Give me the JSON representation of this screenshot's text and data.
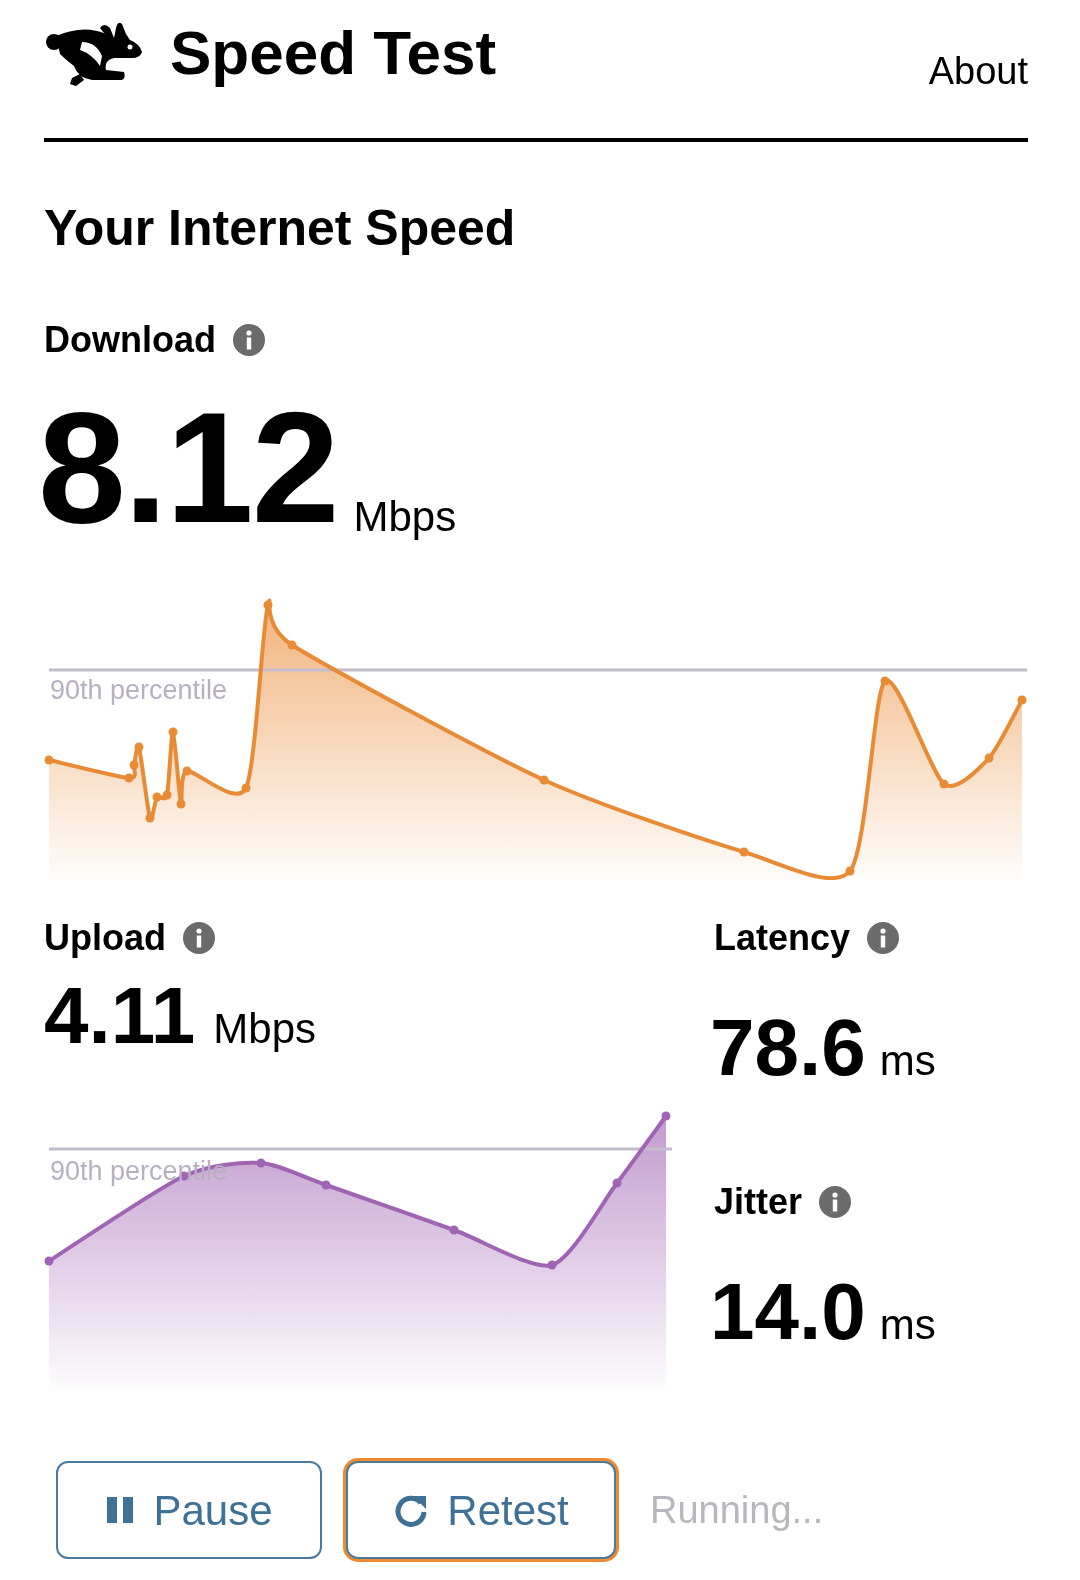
{
  "header": {
    "title": "Speed Test",
    "nav_link": "About"
  },
  "heading": "Your Internet Speed",
  "download": {
    "label": "Download",
    "value": "8.12",
    "unit": "Mbps",
    "chart": {
      "kind": "picture",
      "percentile_label": "90th percentile"
    }
  },
  "upload": {
    "label": "Upload",
    "value": "4.11",
    "unit": "Mbps",
    "chart": {
      "kind": "picture",
      "percentile_label": "90th percentile"
    }
  },
  "latency": {
    "label": "Latency",
    "value": "78.6",
    "unit": "ms"
  },
  "jitter": {
    "label": "Jitter",
    "value": "14.0",
    "unit": "ms"
  },
  "buttons": [
    {
      "kind": "pause",
      "label": "Pause",
      "focused": false
    },
    {
      "kind": "retest",
      "label": "Retest",
      "focused": true
    }
  ],
  "status": "Running..."
}
